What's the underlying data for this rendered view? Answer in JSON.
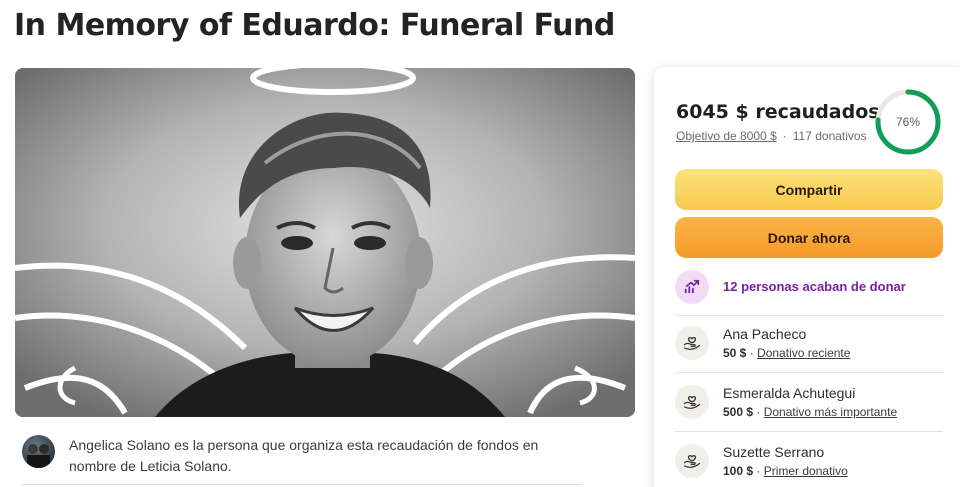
{
  "page": {
    "title": "In Memory of Eduardo: Funeral Fund"
  },
  "organizer": {
    "text": "Angelica Solano es la persona que organiza esta recaudación de fondos en nombre de Leticia Solano."
  },
  "summary": {
    "raised": "6045 $ recaudados",
    "goal": "Objetivo de 8000 $",
    "separator": "·",
    "donations": "117 donativos",
    "percent_label": "76%",
    "progress": 0.76,
    "ring_color": "#0f9d58",
    "ring_track": "#e8e8e8"
  },
  "buttons": {
    "share": "Compartir",
    "donate": "Donar ahora"
  },
  "activity": {
    "text": "12 personas acaban de donar",
    "icon": "trending-up-icon"
  },
  "donors": [
    {
      "name": "Ana Pacheco",
      "amount": "50 $",
      "separator": "·",
      "tag": "Donativo reciente",
      "icon": "donation-hands-icon"
    },
    {
      "name": "Esmeralda Achutegui",
      "amount": "500 $",
      "separator": "·",
      "tag": "Donativo más importante",
      "icon": "donation-hands-icon"
    },
    {
      "name": "Suzette Serrano",
      "amount": "100 $",
      "separator": "·",
      "tag": "Primer donativo",
      "icon": "donation-hands-icon"
    }
  ]
}
